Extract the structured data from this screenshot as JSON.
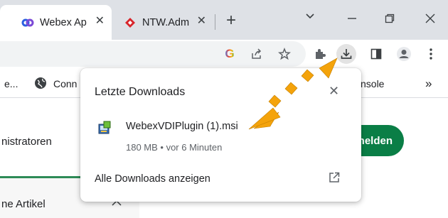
{
  "tabs": [
    {
      "title": "Webex Ap",
      "close": "✕"
    },
    {
      "title": "NTW.Adm",
      "close": "✕"
    }
  ],
  "newtab": "+",
  "window": {
    "chevron": "⌄",
    "restore": "❐",
    "close": "✕"
  },
  "toolbar": {
    "google_icon": "G"
  },
  "bookmarks": {
    "item1": "e...",
    "item2": "Conn",
    "item3": "nsole",
    "more": "»"
  },
  "page": {
    "nav_admin": "nistratoren",
    "button_label": "nelden",
    "article_heading": "ne Artikel",
    "article_chevron": "︿"
  },
  "downloads": {
    "title": "Letzte Downloads",
    "close": "✕",
    "file_name": "WebexVDIPlugin (1).msi",
    "file_meta": "180 MB • vor 6 Minuten",
    "show_all": "Alle Downloads anzeigen"
  },
  "colors": {
    "accent_green": "#0a7e46",
    "arrow": "#f4a30b",
    "webex_blue": "#2b5fe0",
    "ntw_red": "#d8242a"
  }
}
